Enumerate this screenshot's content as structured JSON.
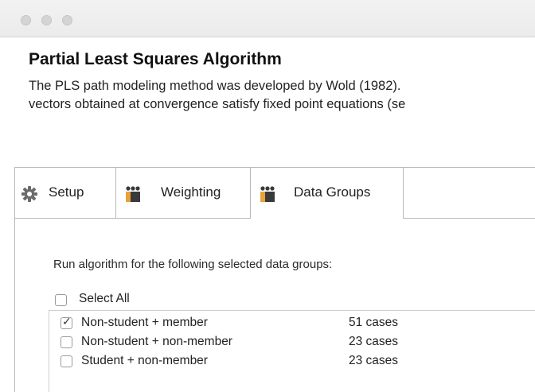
{
  "window": {
    "controls": [
      "close",
      "minimize",
      "zoom"
    ]
  },
  "header": {
    "title": "Partial Least Squares Algorithm",
    "desc_line1": "The PLS path modeling method was developed by Wold (1982).",
    "desc_line2": "vectors obtained at convergence satisfy fixed point equations (se"
  },
  "tabs": [
    {
      "label": "Setup",
      "icon": "gear-icon",
      "active": false
    },
    {
      "label": "Weighting",
      "icon": "people-icon",
      "active": false
    },
    {
      "label": "Data Groups",
      "icon": "people-icon",
      "active": true
    }
  ],
  "data_groups": {
    "instruction": "Run algorithm for the following selected data groups:",
    "select_all": {
      "label": "Select All",
      "checked": false
    },
    "groups": [
      {
        "name": "Non-student + member",
        "cases": "51 cases",
        "checked": true
      },
      {
        "name": "Non-student + non-member",
        "cases": "23 cases",
        "checked": false
      },
      {
        "name": "Student + non-member",
        "cases": "23 cases",
        "checked": false
      }
    ]
  },
  "colors": {
    "border": "#b9b9b9",
    "titlebar": "#ebebeb",
    "control": "#d4d4d4"
  }
}
